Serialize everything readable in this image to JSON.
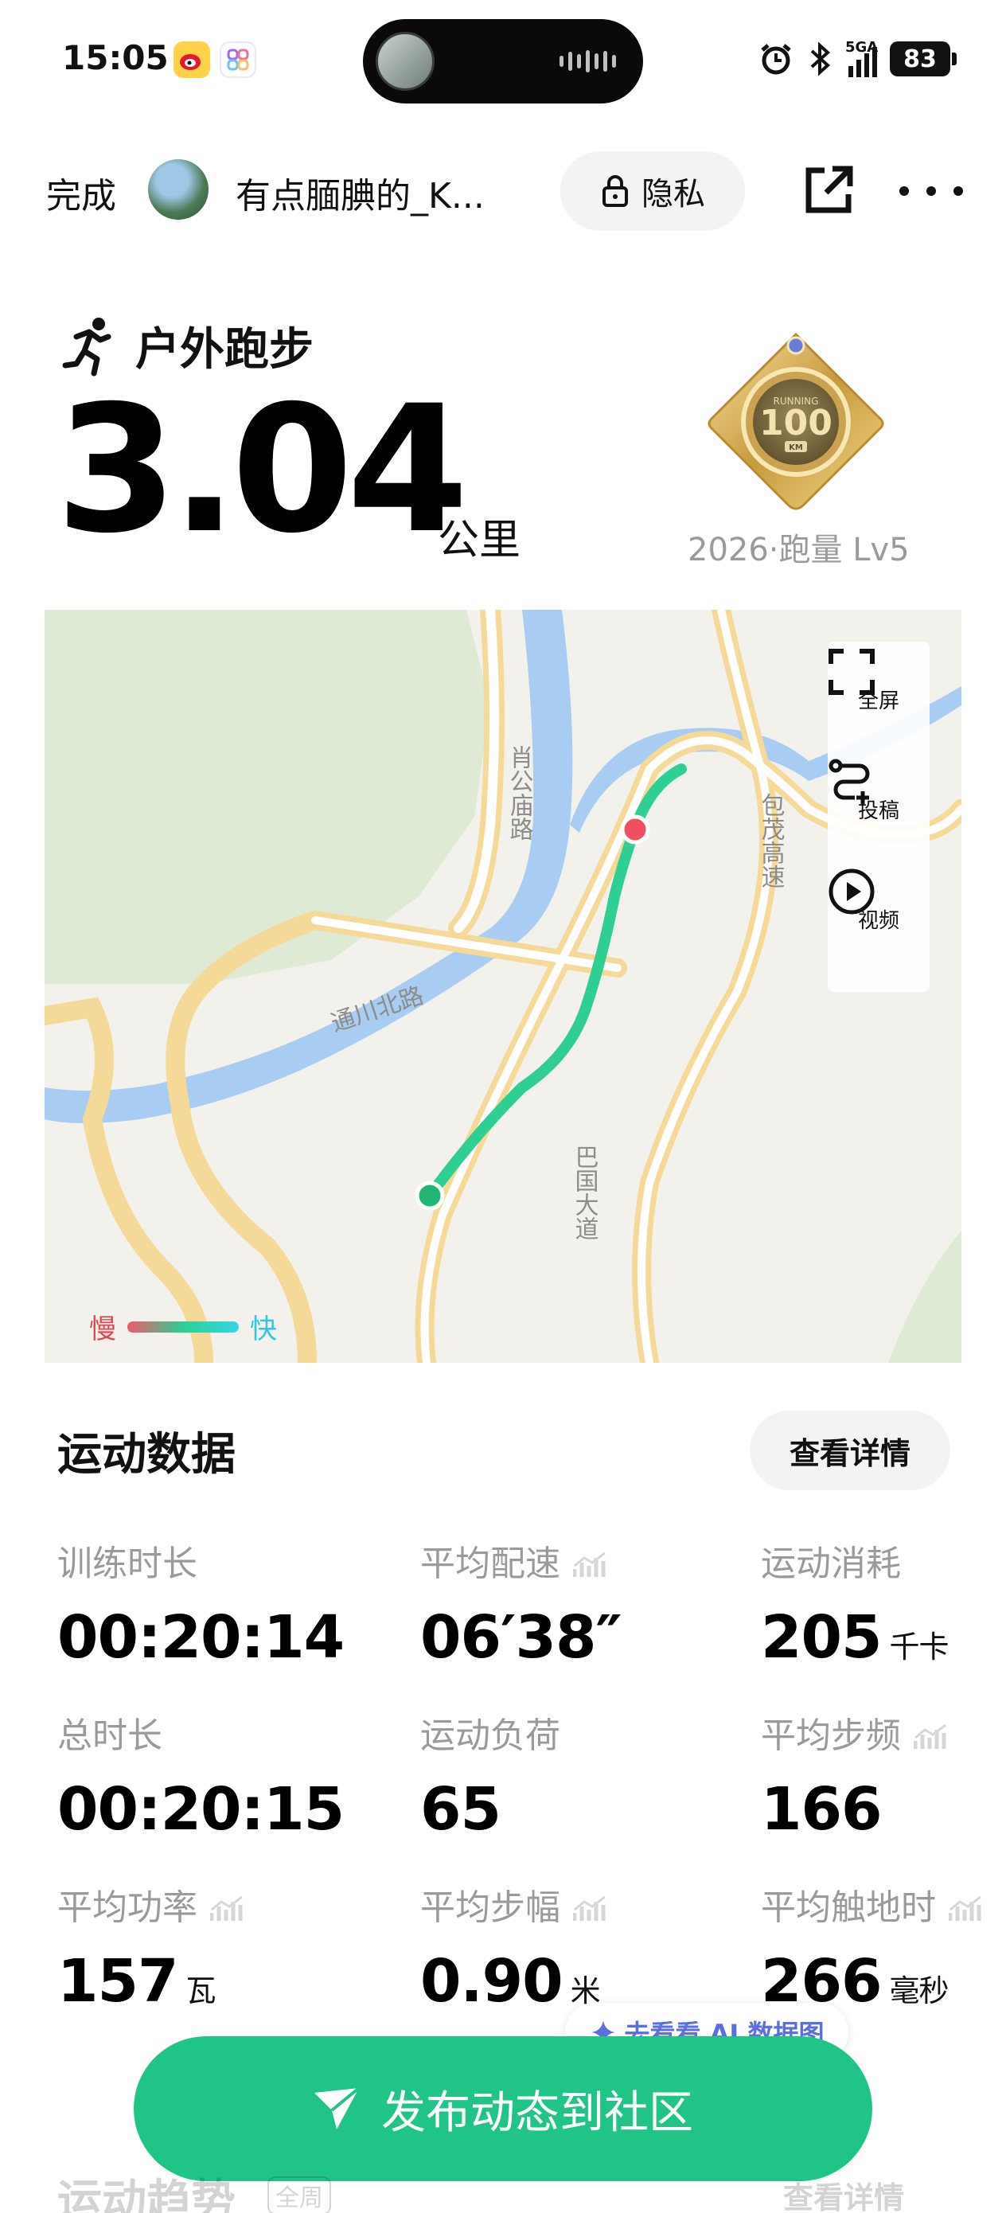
{
  "status_bar": {
    "time": "15:05",
    "battery": "83",
    "network": "5GA",
    "icons": [
      "weibo-icon",
      "app-icon",
      "alarm-icon",
      "bluetooth-icon",
      "signal-icon",
      "battery-icon"
    ]
  },
  "header": {
    "done_label": "完成",
    "username": "有点腼腆的_K...",
    "privacy_label": "隐私",
    "icons": [
      "lock-icon",
      "share-icon",
      "more-icon"
    ]
  },
  "summary": {
    "sport_type": "户外跑步",
    "distance": "3.04",
    "distance_unit": "公里",
    "medal_label": "2026·跑量 Lv5",
    "medal_text": "100",
    "medal_sub": "RUNNING",
    "medal_tag": "KM"
  },
  "map": {
    "road_labels": [
      "肖公庙路",
      "通川北路",
      "包茂高速",
      "巴国大道"
    ],
    "tools": [
      {
        "label": "全屏",
        "icon": "fullscreen-icon"
      },
      {
        "label": "投稿",
        "icon": "route-submit-icon"
      },
      {
        "label": "视频",
        "icon": "play-icon"
      }
    ],
    "legend_slow": "慢",
    "legend_fast": "快",
    "colors": {
      "water": "#a9cdf2",
      "road": "#f4d999",
      "green": "#dfead4",
      "route": "#2fcf93",
      "start": "#22b573",
      "end": "#ef4f5f"
    }
  },
  "sports_data": {
    "title": "运动数据",
    "details_label": "查看详情",
    "metrics": [
      {
        "label": "训练时长",
        "value": "00:20:14",
        "unit": "",
        "chart": false
      },
      {
        "label": "平均配速",
        "value": "06′38″",
        "unit": "",
        "chart": true
      },
      {
        "label": "运动消耗",
        "value": "205",
        "unit": "千卡",
        "chart": false
      },
      {
        "label": "总时长",
        "value": "00:20:15",
        "unit": "",
        "chart": false
      },
      {
        "label": "运动负荷",
        "value": "65",
        "unit": "",
        "chart": false
      },
      {
        "label": "平均步频",
        "value": "166",
        "unit": "",
        "chart": true
      },
      {
        "label": "平均功率",
        "value": "157",
        "unit": "瓦",
        "chart": true
      },
      {
        "label": "平均步幅",
        "value": "0.90",
        "unit": "米",
        "chart": true
      },
      {
        "label": "平均触地时",
        "value": "266",
        "unit": "毫秒",
        "chart": true
      }
    ]
  },
  "ai_pill": {
    "label": "去看看 AI 数据图"
  },
  "cta": {
    "label": "发布动态到社区"
  },
  "ghost": {
    "title": "运动趋势",
    "chip": "全周",
    "details": "查看详情"
  },
  "accent": "#21c487"
}
